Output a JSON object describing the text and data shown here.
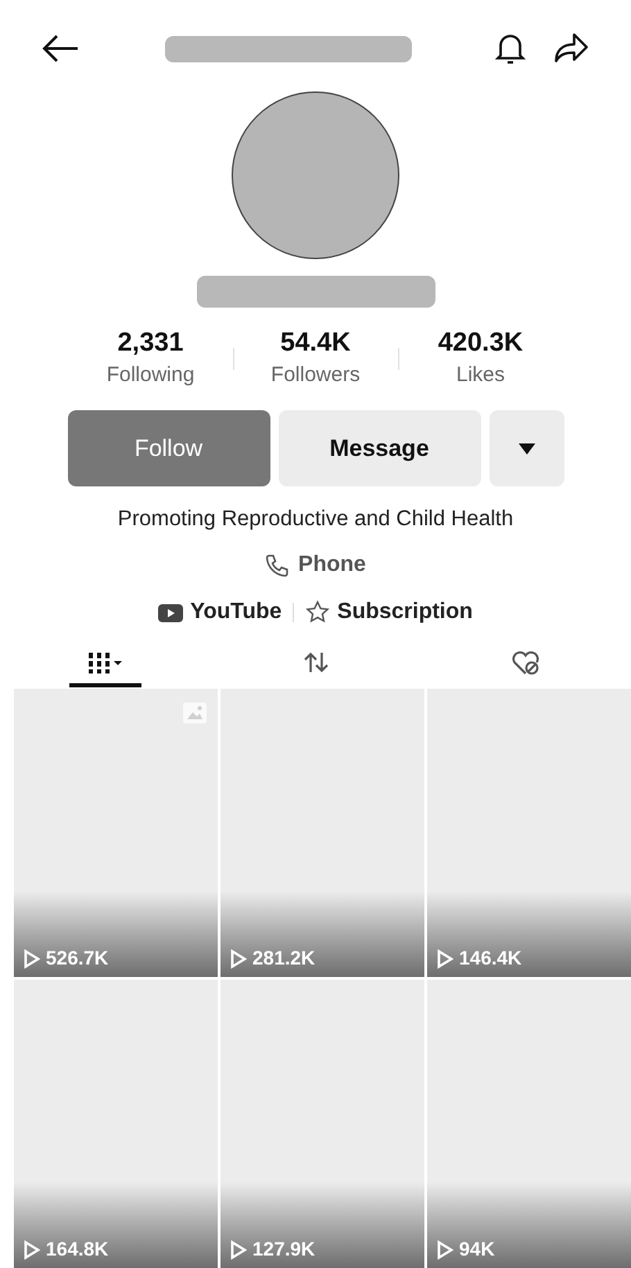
{
  "stats": [
    {
      "value": "2,331",
      "label": "Following"
    },
    {
      "value": "54.4K",
      "label": "Followers"
    },
    {
      "value": "420.3K",
      "label": "Likes"
    }
  ],
  "buttons": {
    "follow": "Follow",
    "message": "Message"
  },
  "bio": "Promoting Reproductive and Child Health",
  "phone": "Phone",
  "links": [
    {
      "kind": "youtube",
      "label": "YouTube"
    },
    {
      "kind": "subscription",
      "label": "Subscription"
    }
  ],
  "tabs": [
    {
      "kind": "videos",
      "selected": true
    },
    {
      "kind": "reposts",
      "selected": false
    },
    {
      "kind": "liked",
      "selected": false
    }
  ],
  "videos": [
    {
      "views": "526.7K",
      "photo_post": true
    },
    {
      "views": "281.2K",
      "photo_post": false
    },
    {
      "views": "146.4K",
      "photo_post": false
    },
    {
      "views": "164.8K",
      "photo_post": false
    },
    {
      "views": "127.9K",
      "photo_post": false
    },
    {
      "views": "94K",
      "photo_post": false
    }
  ]
}
